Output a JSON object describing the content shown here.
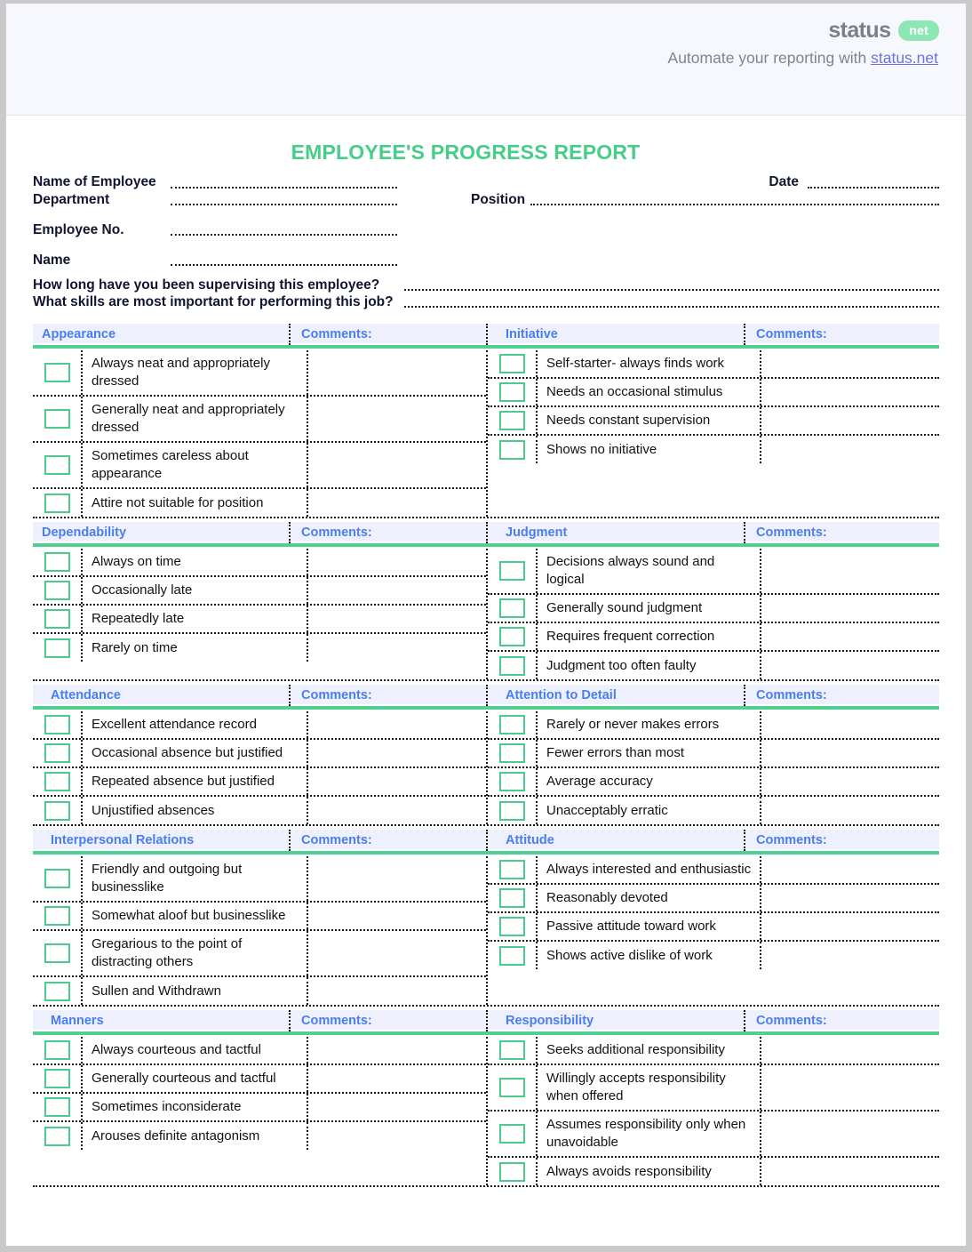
{
  "brand": {
    "logo_word": "status",
    "logo_pill": "net",
    "tagline_prefix": "Automate your reporting with ",
    "tagline_link": "status.net",
    "accent_green": "#8de7b4",
    "link_color": "#6d72e0"
  },
  "document": {
    "title": "EMPLOYEE'S PROGRESS REPORT",
    "title_color": "#46cd88"
  },
  "fields": {
    "name_of_employee": "Name of Employee",
    "date": "Date",
    "department": "Department",
    "position": "Position",
    "employee_no": "Employee No.",
    "name": "Name",
    "question_1": "How long have you been supervising this employee?",
    "question_2": "What skills are most important for performing this job?"
  },
  "labels": {
    "comments": "Comments:"
  },
  "colors": {
    "section_title": "#4a7ef0",
    "section_band": "#eef1fd",
    "checkbox_border": "#4cc98c",
    "rule_green": "#4fcf92"
  },
  "sections": [
    {
      "title": "Appearance",
      "indent": false,
      "items": [
        "Always neat and appropriately dressed",
        "Generally neat and appropriately dressed",
        "Sometimes careless about appearance",
        "Attire not suitable for position"
      ]
    },
    {
      "title": "Initiative",
      "indent": true,
      "items": [
        "Self-starter- always finds work",
        "Needs an occasional stimulus",
        "Needs constant supervision",
        "Shows no initiative"
      ]
    },
    {
      "title": "Dependability",
      "indent": false,
      "items": [
        "Always on time",
        "Occasionally late",
        "Repeatedly late",
        "Rarely on time"
      ]
    },
    {
      "title": "Judgment",
      "indent": true,
      "items": [
        "Decisions always sound and logical",
        "Generally sound judgment",
        "Requires frequent correction",
        "Judgment too often faulty"
      ]
    },
    {
      "title": "Attendance",
      "indent": true,
      "items": [
        "Excellent attendance record",
        "Occasional absence but justified",
        "Repeated absence but justified",
        "Unjustified absences"
      ]
    },
    {
      "title": "Attention to Detail",
      "indent": true,
      "items": [
        "Rarely or never makes errors",
        "Fewer errors than most",
        "Average accuracy",
        "Unacceptably erratic"
      ]
    },
    {
      "title": "Interpersonal Relations",
      "indent": true,
      "items": [
        "Friendly and outgoing but businesslike",
        "Somewhat aloof but businesslike",
        "Gregarious to the point of distracting others",
        "Sullen and Withdrawn"
      ]
    },
    {
      "title": "Attitude",
      "indent": true,
      "items": [
        "Always interested and enthusiastic",
        "Reasonably devoted",
        "Passive attitude toward work",
        "Shows active dislike of work"
      ]
    },
    {
      "title": "Manners",
      "indent": true,
      "items": [
        "Always courteous and tactful",
        "Generally courteous and tactful",
        "Sometimes inconsiderate",
        "Arouses definite antagonism"
      ]
    },
    {
      "title": "Responsibility",
      "indent": true,
      "items": [
        "Seeks  additional responsibility",
        "Willingly accepts responsibility when offered",
        "Assumes responsibility only when unavoidable",
        "Always avoids responsibility"
      ]
    }
  ]
}
